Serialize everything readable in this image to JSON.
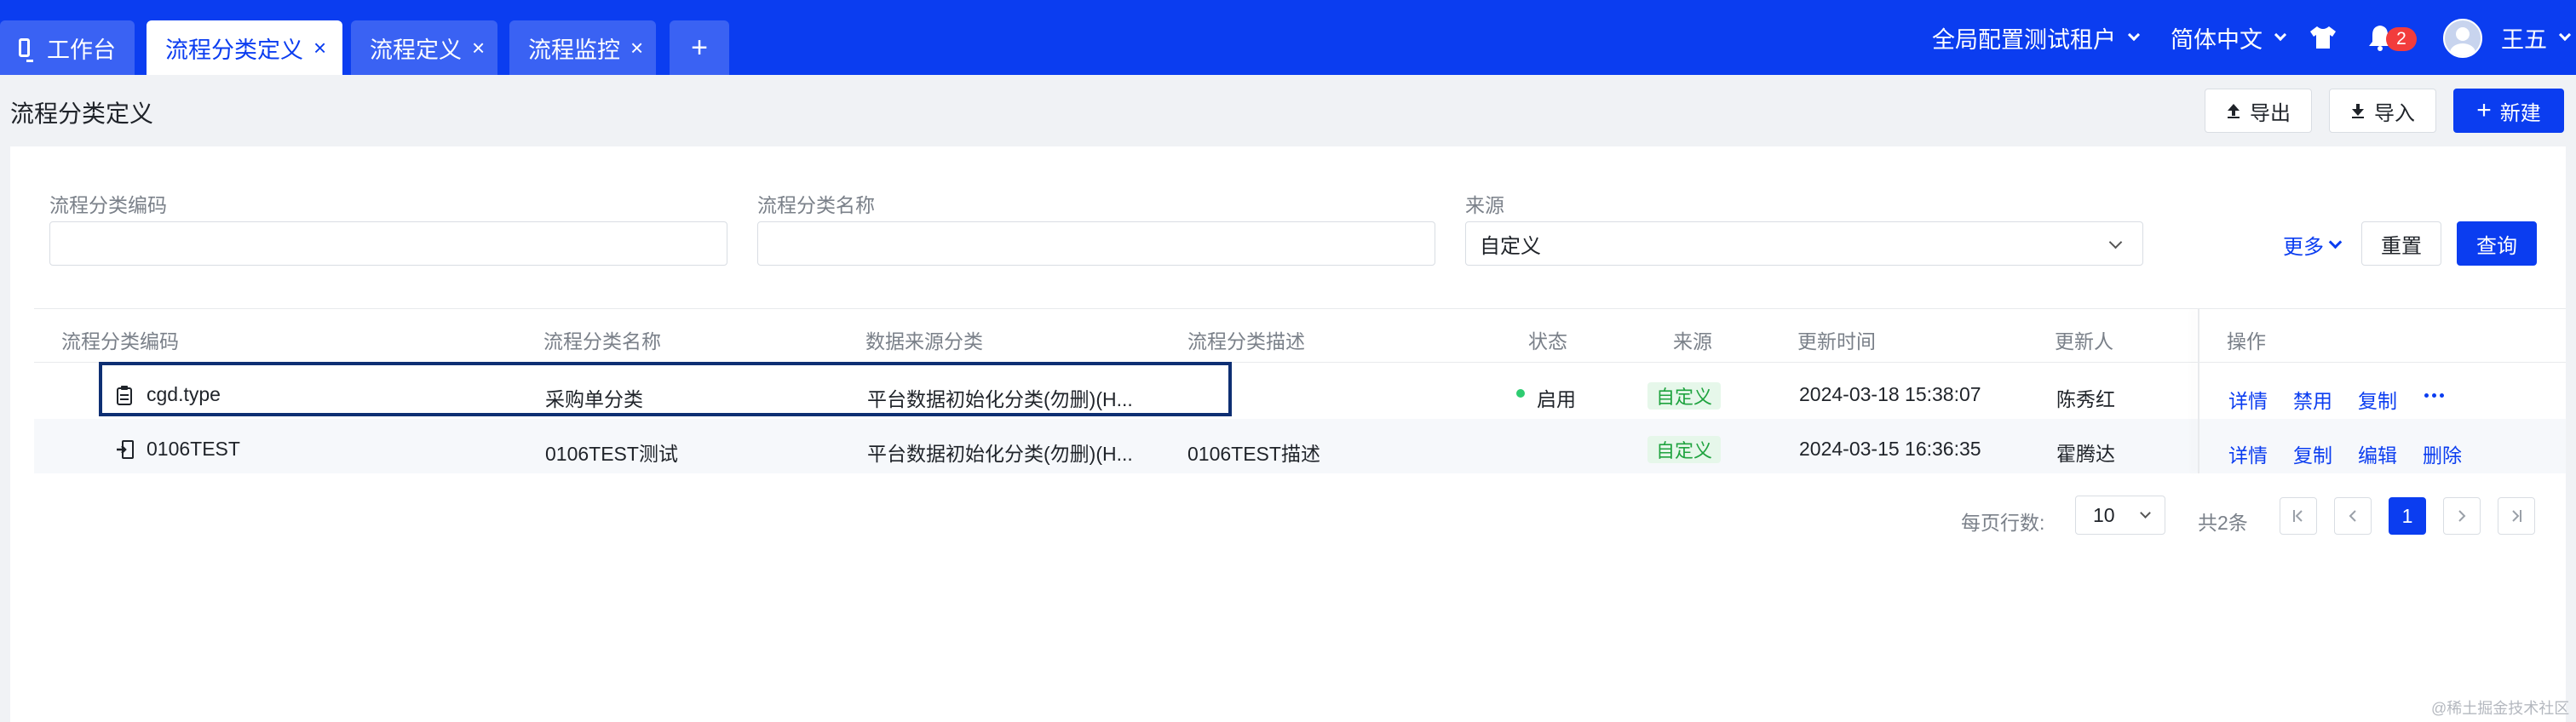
{
  "tabs": [
    {
      "label": "工作台",
      "active": false,
      "closable": false
    },
    {
      "label": "流程分类定义",
      "active": true,
      "closable": true
    },
    {
      "label": "流程定义",
      "active": false,
      "closable": true
    },
    {
      "label": "流程监控",
      "active": false,
      "closable": true
    }
  ],
  "tab_close_glyph": "×",
  "add_tab_glyph": "+",
  "header": {
    "tenant": "全局配置测试租户",
    "language": "简体中文",
    "notification_count": "2",
    "user_name": "王五"
  },
  "page": {
    "title": "流程分类定义",
    "export_label": "导出",
    "import_label": "导入",
    "new_label": "新建",
    "new_glyph": "+"
  },
  "filters": {
    "code_label": "流程分类编码",
    "code_value": "",
    "name_label": "流程分类名称",
    "name_value": "",
    "source_label": "来源",
    "source_value": "自定义",
    "more_label": "更多",
    "reset_label": "重置",
    "query_label": "查询"
  },
  "table": {
    "columns": [
      "流程分类编码",
      "流程分类名称",
      "数据来源分类",
      "流程分类描述",
      "状态",
      "来源",
      "更新时间",
      "更新人",
      "操作"
    ],
    "rows": [
      {
        "code": "cgd.type",
        "name": "采购单分类",
        "data_source": "平台数据初始化分类(勿删)(H...",
        "description": "",
        "status": "启用",
        "source": "自定义",
        "updated_at": "2024-03-18 15:38:07",
        "updated_by": "陈秀红",
        "actions": [
          "详情",
          "禁用",
          "复制"
        ]
      },
      {
        "code": "0106TEST",
        "name": "0106TEST测试",
        "data_source": "平台数据初始化分类(勿删)(H...",
        "description": "0106TEST描述",
        "status": "",
        "source": "自定义",
        "updated_at": "2024-03-15 16:36:35",
        "updated_by": "霍腾达",
        "actions": [
          "详情",
          "复制",
          "编辑",
          "删除"
        ]
      }
    ]
  },
  "pagination": {
    "rows_per_page_label": "每页行数:",
    "rows_per_page": "10",
    "total_label": "共2条",
    "current_page": "1"
  },
  "watermark": "@稀土掘金技术社区",
  "colors": {
    "brand_blue": "#0b3df0",
    "highlight_border": "#0e2f73",
    "status_green": "#2ecc71",
    "tag_green": "#1fa33f",
    "badge_red": "#f23c3c"
  },
  "icons": [
    "workbench-icon",
    "close-icon",
    "plus-icon",
    "chevron-down-icon",
    "shirt-icon",
    "bell-icon",
    "avatar",
    "upload-icon",
    "download-icon",
    "clipboard-icon",
    "export-doc-icon",
    "ellipsis-icon",
    "first-page-icon",
    "prev-page-icon",
    "next-page-icon",
    "last-page-icon"
  ]
}
